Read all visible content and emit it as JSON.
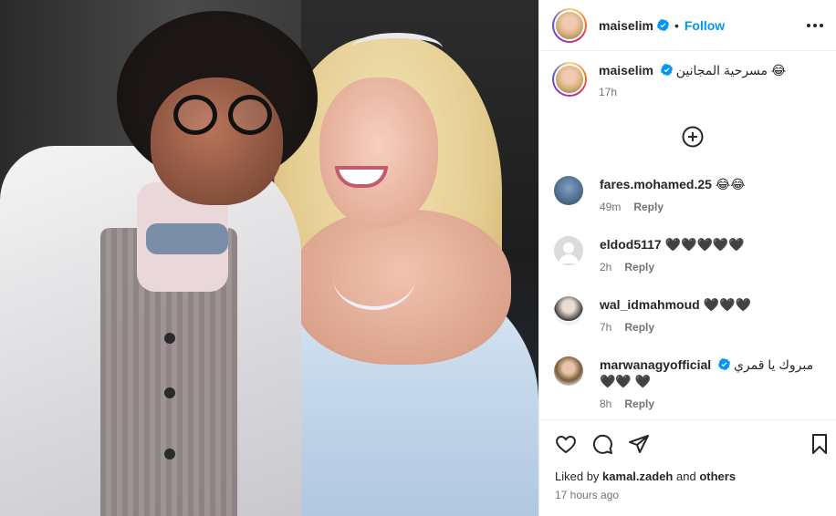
{
  "post": {
    "username": "maiselim",
    "follow_label": "Follow",
    "separator": "•",
    "caption_text": "مسرحية المجانين 😂",
    "caption_time": "17h",
    "likes_prefix": "Liked by",
    "likes_user": "kamal.zadeh",
    "likes_and": "and",
    "likes_suffix": "others",
    "time_ago": "17 hours ago"
  },
  "comments": [
    {
      "username": "fares.mohamed.25",
      "text": "😂😂",
      "time": "49m",
      "reply": "Reply"
    },
    {
      "username": "eldod5117",
      "text": "🖤🖤🖤🖤🖤",
      "time": "2h",
      "reply": "Reply"
    },
    {
      "username": "wal_idmahmoud",
      "text": "🖤🖤🖤",
      "time": "7h",
      "reply": "Reply"
    },
    {
      "username": "marwanagyofficial",
      "text": "مبروك يا قمري 🖤🖤 🖤",
      "time": "8h",
      "reply": "Reply",
      "verified": true
    }
  ],
  "colors": {
    "accent": "#0095f6",
    "verified": "#0095f6",
    "muted": "#737373"
  },
  "icons": [
    "verified-badge-icon",
    "more-options-icon",
    "add-comment-icon",
    "heart-icon",
    "comment-icon",
    "share-icon",
    "bookmark-icon"
  ]
}
